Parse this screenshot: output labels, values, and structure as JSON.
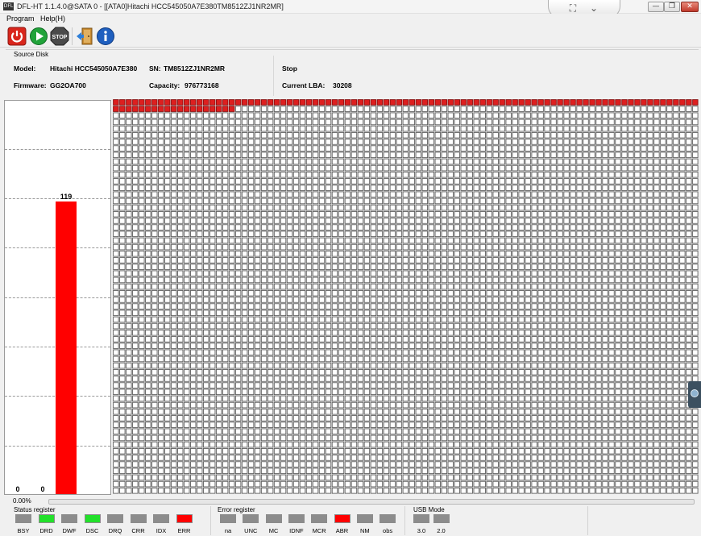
{
  "window": {
    "title": "DFL-HT 1.1.4.0@SATA 0 - [[ATA0]Hitachi HCC545050A7E380TM8512ZJ1NR2MR]",
    "icon_text": "DFL",
    "ribbon_buttons": [
      "fit-screen-icon",
      "collapse-chevron-icon"
    ],
    "controls": {
      "minimize": "—",
      "restore": "❐",
      "close": "✕"
    }
  },
  "menu": [
    "Program",
    "Help(H)"
  ],
  "toolbar": [
    {
      "name": "power-icon",
      "color": "#d9261c"
    },
    {
      "name": "play-icon",
      "color": "#21a33a"
    },
    {
      "name": "stop-icon",
      "color": "#4a4a4a",
      "text": "STOP"
    },
    {
      "name": "exit-door-icon",
      "color": "#c98a2f"
    },
    {
      "name": "info-icon",
      "color": "#1f5fbf"
    }
  ],
  "source_disk": {
    "title": "Source Disk",
    "model_label": "Model:",
    "model": "Hitachi HCC545050A7E380",
    "sn_label": "SN:",
    "sn": "TM8512ZJ1NR2MR",
    "firmware_label": "Firmware:",
    "firmware": "GG2OA700",
    "capacity_label": "Capacity:",
    "capacity": "976773168",
    "status": "Stop",
    "current_lba_label": "Current LBA:",
    "current_lba": "30208"
  },
  "chart_data": {
    "type": "bar",
    "categories": [
      "",
      "",
      ""
    ],
    "values": [
      0,
      0,
      119
    ],
    "ylim": [
      0,
      160
    ],
    "grid": true,
    "colors": [
      "#ff0000"
    ]
  },
  "sector_map": {
    "columns": 91,
    "rows": 60,
    "error_count": 110,
    "error_color": "#dd1f1f",
    "empty_color": "#ffffff",
    "border_color": "#5f5f5f"
  },
  "progress": {
    "text": "0.00%",
    "value": 0
  },
  "status_register": {
    "title": "Status register",
    "leds": [
      {
        "label": "BSY",
        "color": "#8c8c8c"
      },
      {
        "label": "DRD",
        "color": "#22e02a"
      },
      {
        "label": "DWF",
        "color": "#8c8c8c"
      },
      {
        "label": "DSC",
        "color": "#22e02a"
      },
      {
        "label": "DRQ",
        "color": "#8c8c8c"
      },
      {
        "label": "CRR",
        "color": "#8c8c8c"
      },
      {
        "label": "IDX",
        "color": "#8c8c8c"
      },
      {
        "label": "ERR",
        "color": "#ff0000"
      }
    ]
  },
  "error_register": {
    "title": "Error register",
    "leds": [
      {
        "label": "na",
        "color": "#8c8c8c"
      },
      {
        "label": "UNC",
        "color": "#8c8c8c"
      },
      {
        "label": "MC",
        "color": "#8c8c8c"
      },
      {
        "label": "IDNF",
        "color": "#8c8c8c"
      },
      {
        "label": "MCR",
        "color": "#8c8c8c"
      },
      {
        "label": "ABR",
        "color": "#ff0000"
      },
      {
        "label": "NM",
        "color": "#8c8c8c"
      },
      {
        "label": "obs",
        "color": "#8c8c8c"
      }
    ]
  },
  "usb_mode": {
    "title": "USB Mode",
    "leds": [
      {
        "label": "3.0",
        "color": "#8c8c8c"
      },
      {
        "label": "2.0",
        "color": "#8c8c8c"
      }
    ]
  }
}
